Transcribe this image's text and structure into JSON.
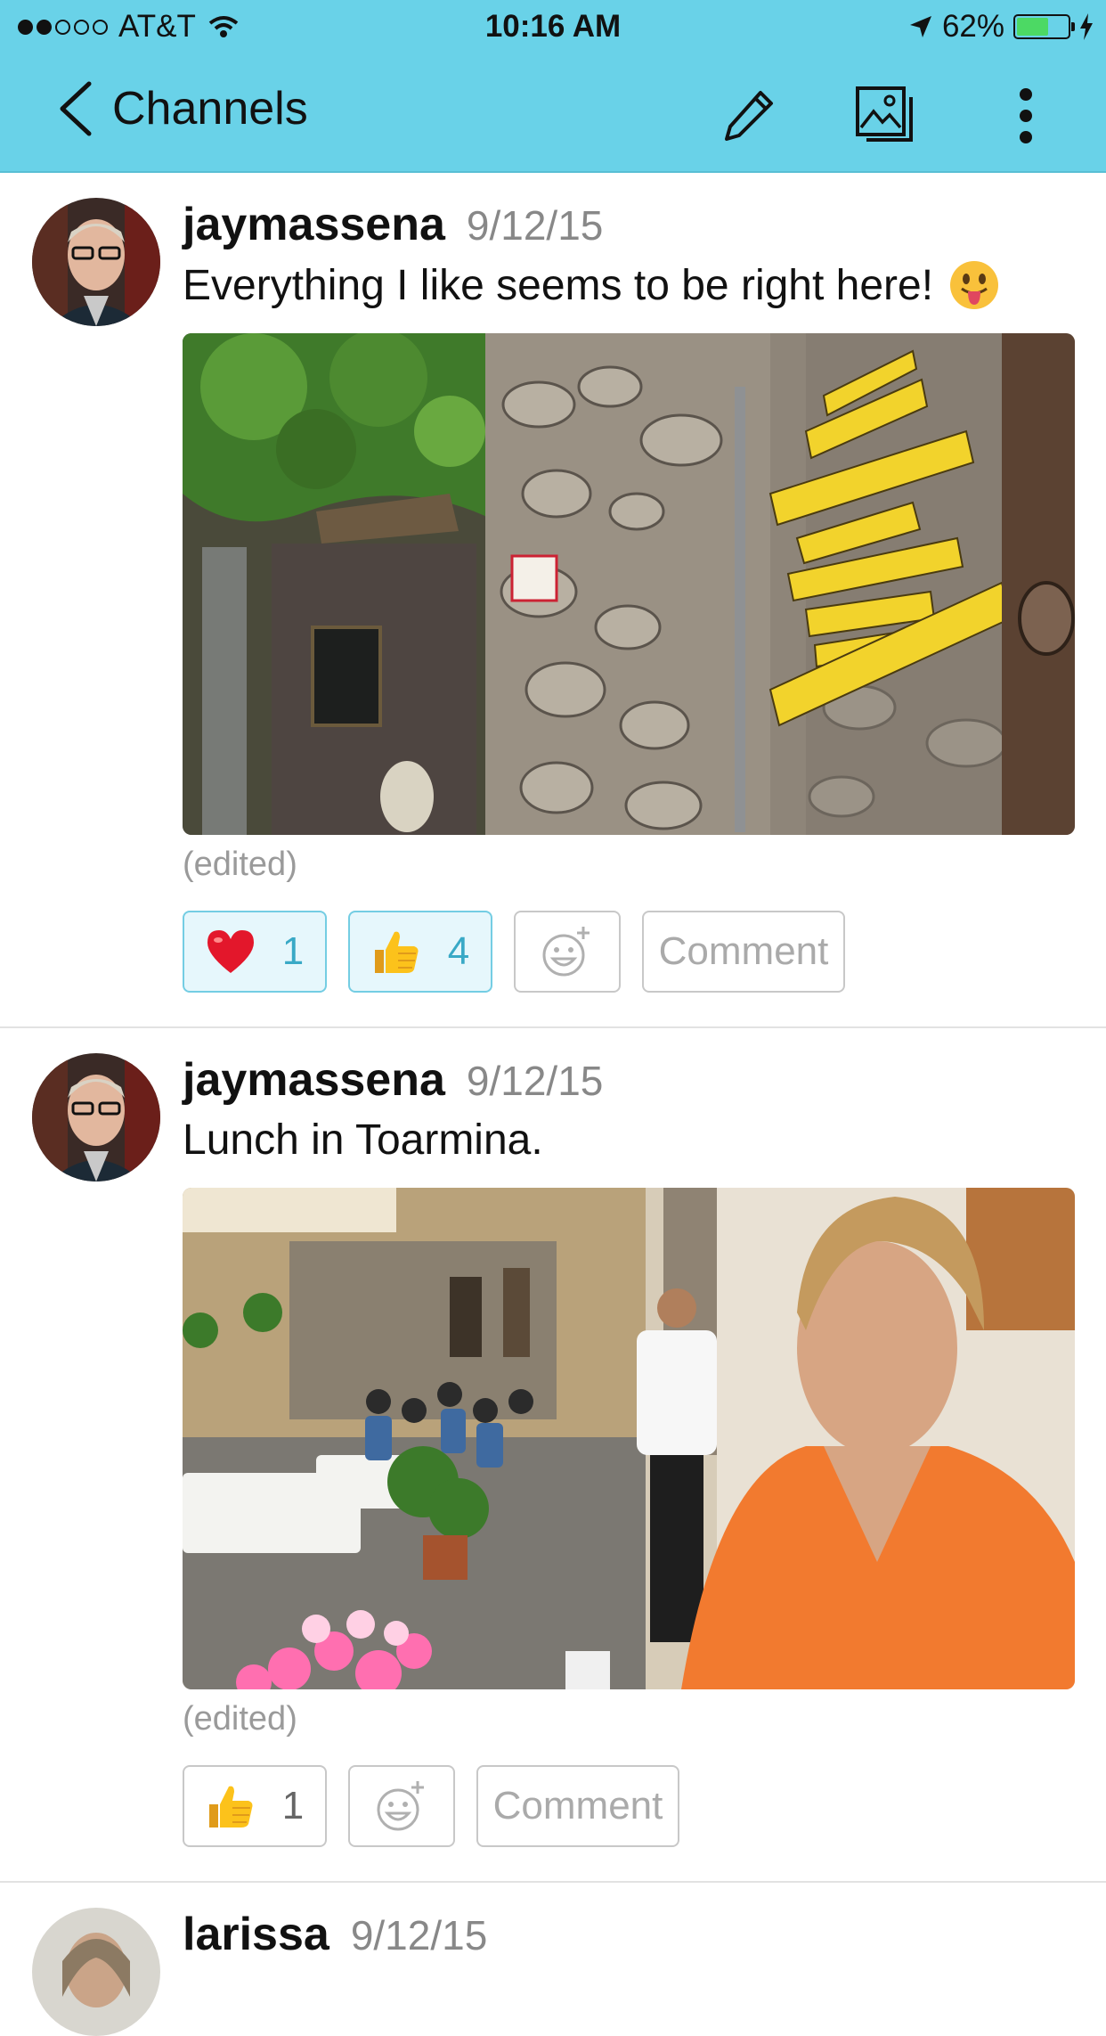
{
  "status_bar": {
    "carrier": "AT&T",
    "time": "10:16 AM",
    "battery": "62%",
    "battery_level": 0.62,
    "signal_bars": 2
  },
  "nav": {
    "back_label": "Channels",
    "icons": [
      "chevron-left-icon",
      "pencil-icon",
      "gallery-icon",
      "more-vertical-icon"
    ]
  },
  "posts": [
    {
      "author": "jaymassena",
      "date": "9/12/15",
      "message": "Everything I like seems to be right here!",
      "message_emoji": "tongue-face",
      "edited": "(edited)",
      "reactions": [
        {
          "emoji": "heart",
          "count": "1",
          "active": true
        },
        {
          "emoji": "thumbs-up",
          "count": "4",
          "active": true
        }
      ],
      "comment_label": "Comment"
    },
    {
      "author": "jaymassena",
      "date": "9/12/15",
      "message": "Lunch in Toarmina.",
      "edited": "(edited)",
      "reactions": [
        {
          "emoji": "thumbs-up",
          "count": "1",
          "active": false
        }
      ],
      "comment_label": "Comment"
    },
    {
      "author": "larissa",
      "date": "9/12/15"
    }
  ],
  "colors": {
    "header": "#69d2e8",
    "reaction_active_bg": "#e6f7fc",
    "reaction_active_border": "#74cde3",
    "reaction_active_text": "#39a9c6"
  }
}
